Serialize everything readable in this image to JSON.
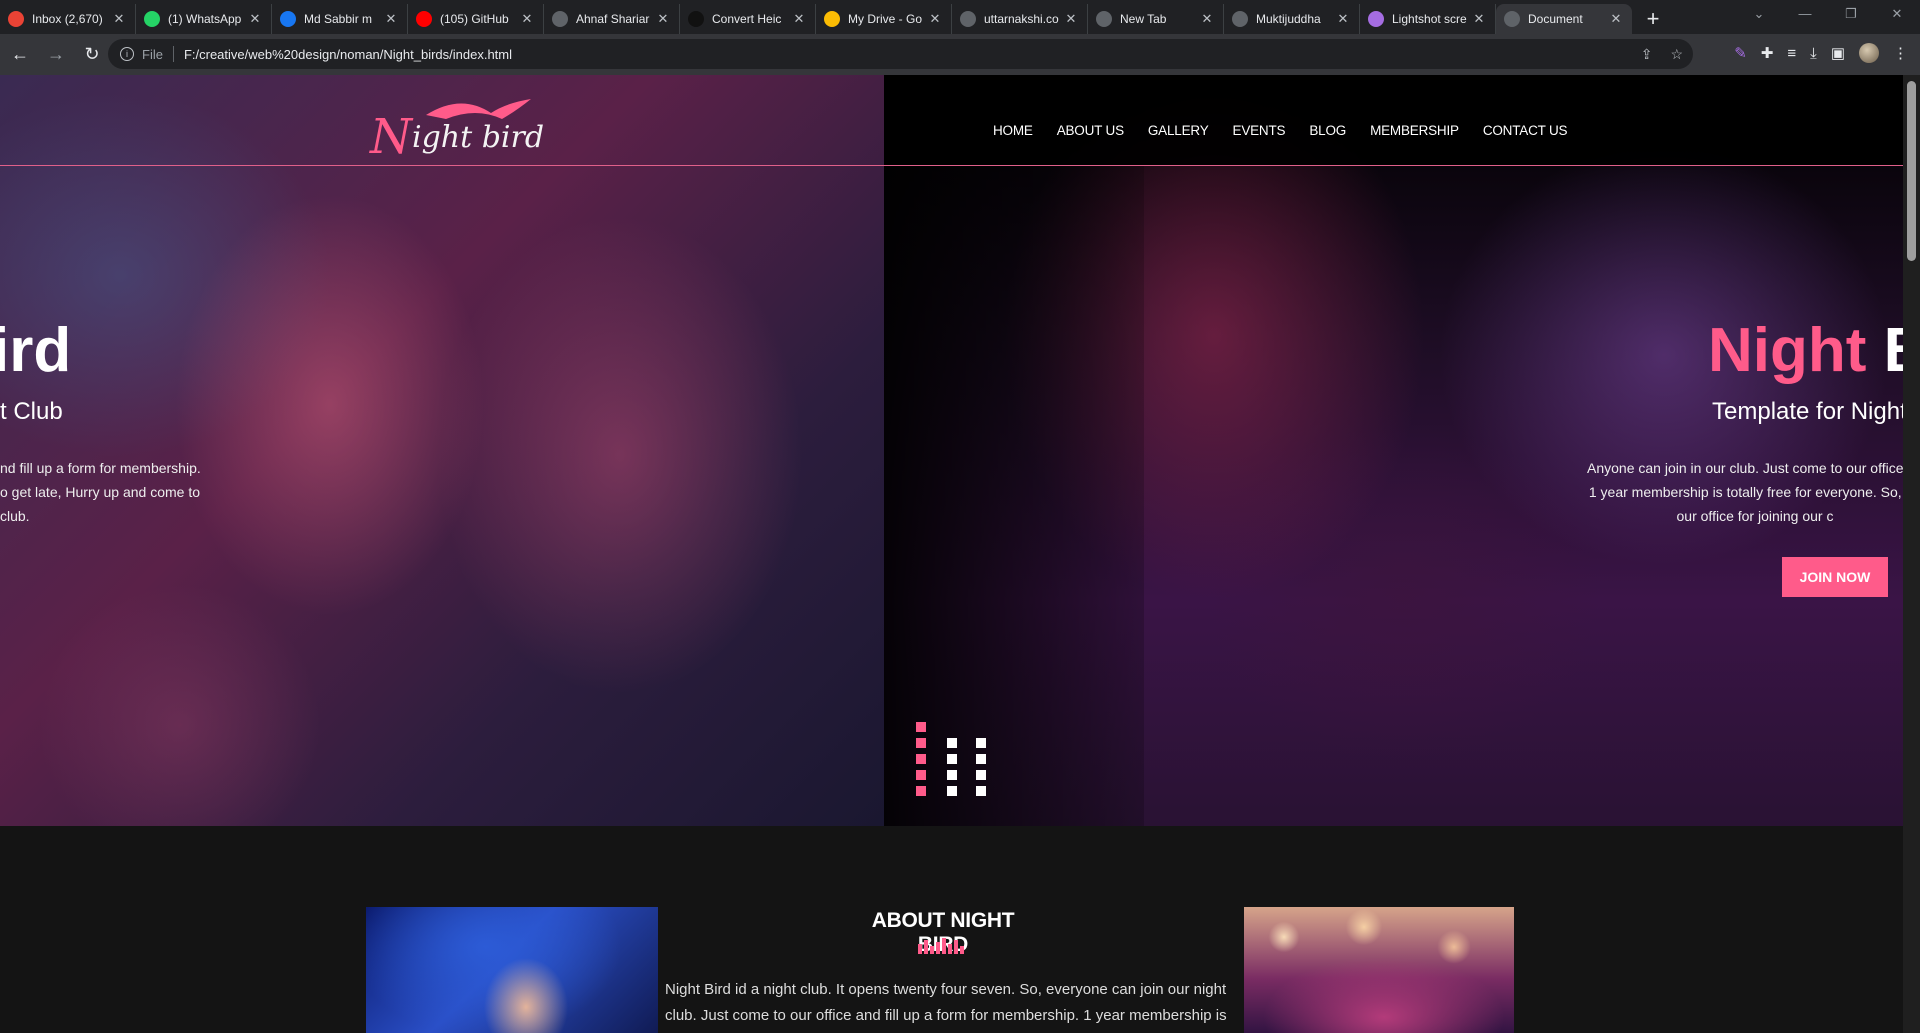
{
  "browser": {
    "tabs": [
      {
        "label": "Inbox (2,670)",
        "icon": "gmail-icon",
        "color": "#ea4335"
      },
      {
        "label": "(1) WhatsApp",
        "icon": "whatsapp-icon",
        "color": "#25d366"
      },
      {
        "label": "Md Sabbir m",
        "icon": "facebook-icon",
        "color": "#1877f2"
      },
      {
        "label": "(105) GitHub",
        "icon": "youtube-icon",
        "color": "#ff0000"
      },
      {
        "label": "Ahnaf Shariar",
        "icon": "globe-icon",
        "color": "#5f6368"
      },
      {
        "label": "Convert Heic",
        "icon": "h-icon",
        "color": "#111111"
      },
      {
        "label": "My Drive - Go",
        "icon": "drive-icon",
        "color": "#fbbc04"
      },
      {
        "label": "uttarnakshi.co",
        "icon": "globe-icon",
        "color": "#5f6368"
      },
      {
        "label": "New Tab",
        "icon": "chrome-icon",
        "color": "#5f6368"
      },
      {
        "label": "Muktijuddha",
        "icon": "globe-icon",
        "color": "#5f6368"
      },
      {
        "label": "Lightshot scre",
        "icon": "feather-icon",
        "color": "#a56de2"
      },
      {
        "label": "Document",
        "icon": "globe-icon",
        "color": "#5f6368"
      }
    ],
    "new_tab": "+",
    "address": {
      "scheme": "File",
      "url": "F:/creative/web%20design/noman/Night_birds/index.html"
    }
  },
  "site": {
    "logo": {
      "n": "N",
      "rest": "ight bird"
    },
    "nav": [
      "HOME",
      "ABOUT US",
      "GALLERY",
      "EVENTS",
      "BLOG",
      "MEMBERSHIP",
      "CONTACT US"
    ],
    "slide_left": {
      "title": "ird",
      "subtitle": "t Club",
      "text": "nd fill up a form for membership.\no get late, Hurry up and come to\nclub."
    },
    "slide_right": {
      "title_pink": "Night",
      "title_white": " Bi",
      "subtitle": "Template for Night",
      "text": "Anyone can join in our club. Just come to our office an\n1 year membership is totally free for everyone. So, no\nour office for joining our c",
      "button": "JOIN NOW"
    },
    "about": {
      "title": "ABOUT NIGHT BIRD",
      "text": "Night Bird id a night club. It opens twenty four seven. So, everyone can join our night\nclub. Just come to our office and fill up a form for membership. 1 year membership is"
    },
    "colors": {
      "accent": "#ff5b8a",
      "background": "#141414"
    }
  }
}
